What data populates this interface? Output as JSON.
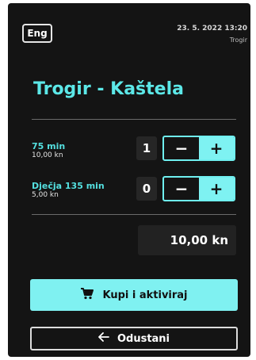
{
  "header": {
    "language_label": "Eng",
    "datetime": "23. 5. 2022 13:20",
    "location": "Trogir"
  },
  "route": {
    "title": "Trogir - Kaštela"
  },
  "tickets": [
    {
      "name": "75 min",
      "price": "10,00 kn",
      "quantity": "1"
    },
    {
      "name": "Dječja 135 min",
      "price": "5,00 kn",
      "quantity": "0"
    }
  ],
  "stepper": {
    "minus_symbol": "−",
    "plus_symbol": "+"
  },
  "total": {
    "amount": "10,00 kn"
  },
  "actions": {
    "buy_label": "Kupi i aktiviraj",
    "cancel_label": "Odustani"
  },
  "colors": {
    "accent": "#7ff1f1",
    "background": "#141414"
  },
  "icons": {
    "buy": "cart-icon",
    "cancel": "arrow-left-icon"
  }
}
